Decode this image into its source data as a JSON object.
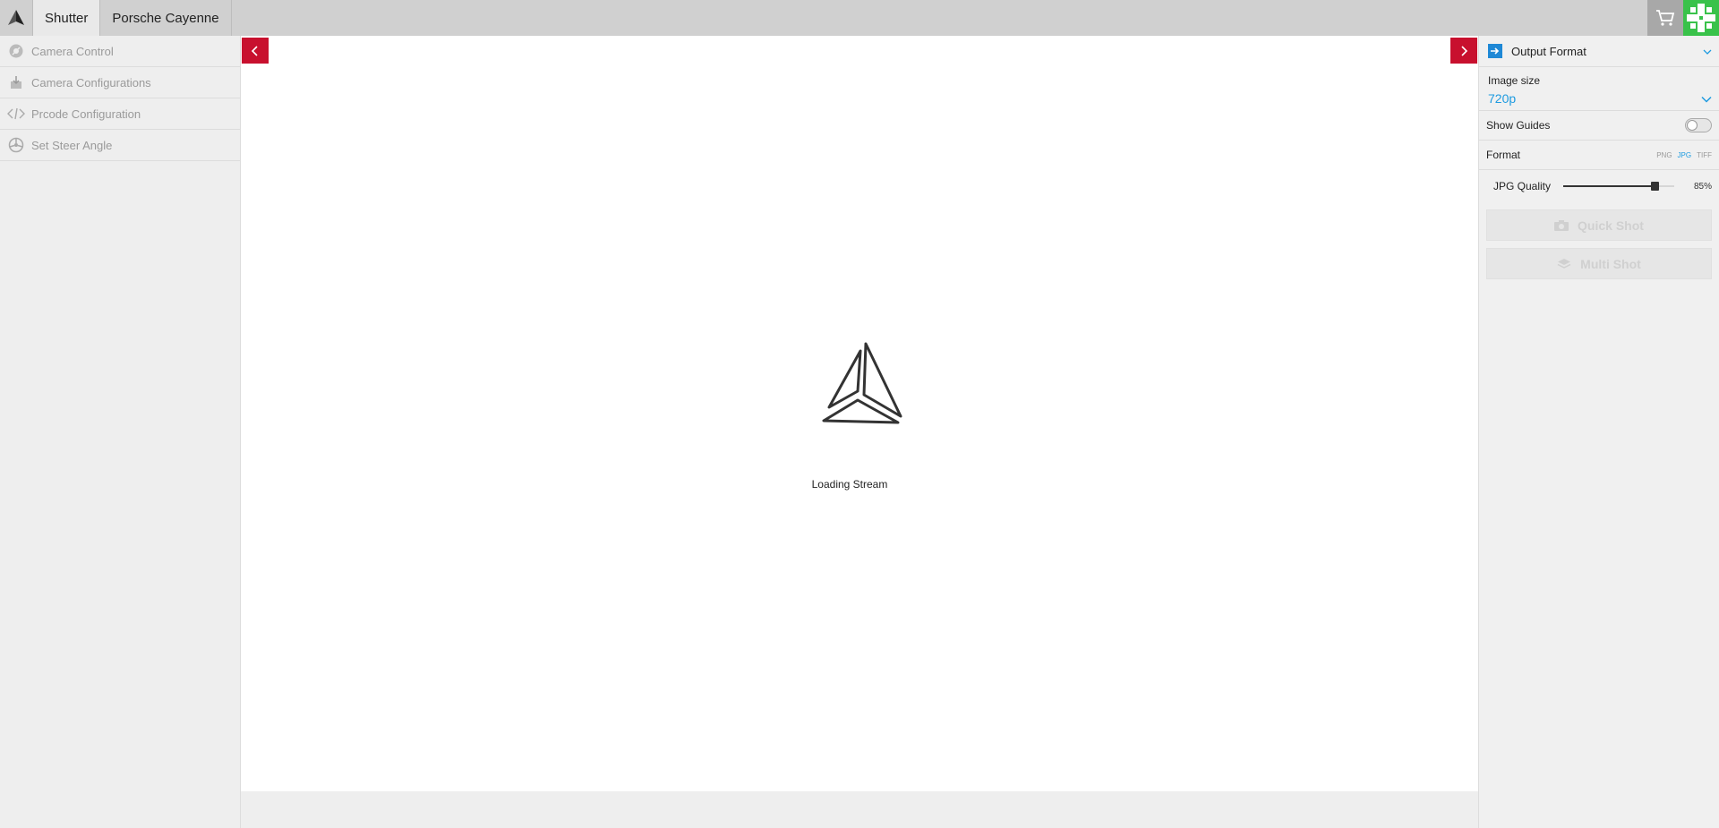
{
  "topbar": {
    "tabs": [
      {
        "label": "Shutter"
      },
      {
        "label": "Porsche Cayenne"
      }
    ],
    "logo_icon": "triangle-logo-icon",
    "cart_icon": "cart-icon",
    "avatar_icon": "avatar-identicon"
  },
  "sidebar": {
    "items": [
      {
        "label": "Camera Control",
        "icon": "camera-control-icon"
      },
      {
        "label": "Camera Configurations",
        "icon": "download-box-icon"
      },
      {
        "label": "Prcode Configuration",
        "icon": "code-icon"
      },
      {
        "label": "Set Steer Angle",
        "icon": "steering-wheel-icon"
      }
    ]
  },
  "main": {
    "loading_text": "Loading Stream",
    "prev_icon": "chevron-left-icon",
    "next_icon": "chevron-right-icon"
  },
  "right_panel": {
    "section_title": "Output Format",
    "image_size": {
      "label": "Image size",
      "value": "720p"
    },
    "show_guides": {
      "label": "Show Guides",
      "enabled": false
    },
    "format": {
      "label": "Format",
      "options": [
        "PNG",
        "JPG",
        "TIFF"
      ],
      "selected": "JPG"
    },
    "jpg_quality": {
      "label": "JPG Quality",
      "value": 85,
      "display": "85%"
    },
    "quick_shot_label": "Quick Shot",
    "multi_shot_label": "Multi Shot"
  },
  "colors": {
    "accent_red": "#c8102e",
    "accent_blue": "#1e9be0",
    "avatar_green": "#39c24a"
  }
}
